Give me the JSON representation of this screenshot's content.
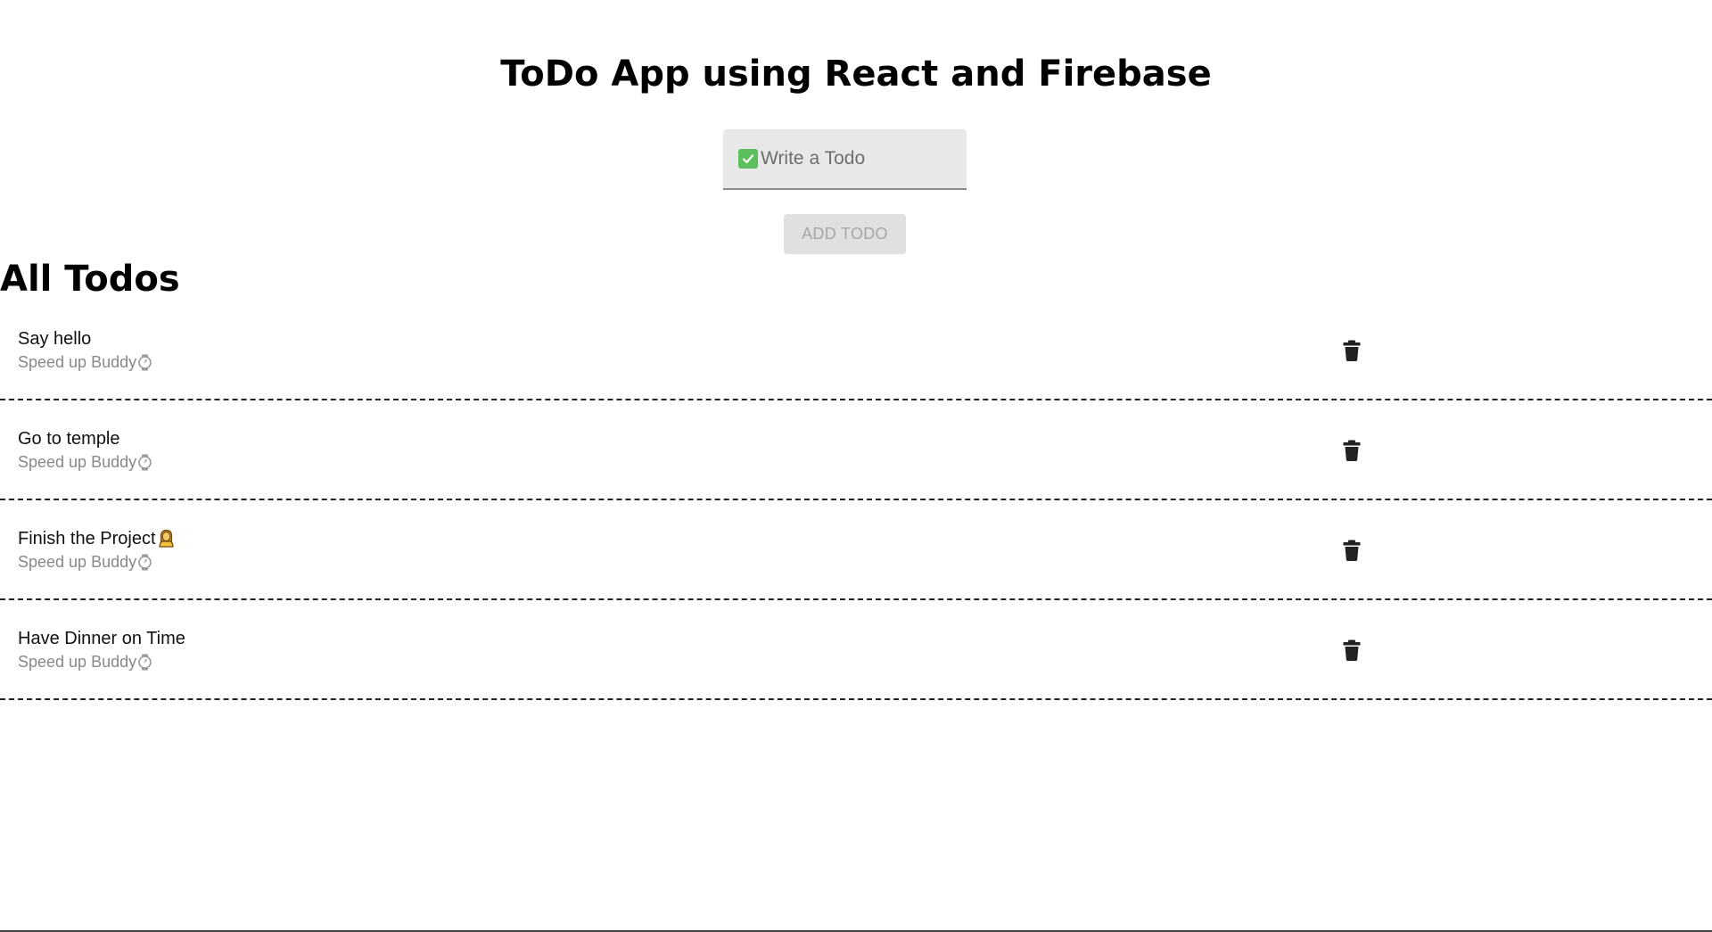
{
  "header": {
    "title": "ToDo App using React and Firebase"
  },
  "form": {
    "input_placeholder": "Write a Todo",
    "input_value": "",
    "add_button_label": "ADD TODO",
    "check_icon": "check-box-icon"
  },
  "section": {
    "title": "All Todos"
  },
  "todos": [
    {
      "text": "Say hello",
      "subtitle": "Speed up Buddy",
      "trailing_icon": null
    },
    {
      "text": "Go to temple",
      "subtitle": "Speed up Buddy",
      "trailing_icon": null
    },
    {
      "text": "Finish the Project",
      "subtitle": "Speed up Buddy",
      "trailing_icon": "person-emoji-icon"
    },
    {
      "text": "Have Dinner on Time",
      "subtitle": "Speed up Buddy",
      "trailing_icon": null
    }
  ],
  "icons": {
    "subtitle": "watch-icon",
    "delete": "trash-icon"
  },
  "colors": {
    "input_bg": "#e8e8e8",
    "check_green": "#5bbf5e",
    "button_disabled_bg": "#e0e0e0",
    "button_disabled_text": "#a6a6a6",
    "subtitle_gray": "#888888"
  }
}
